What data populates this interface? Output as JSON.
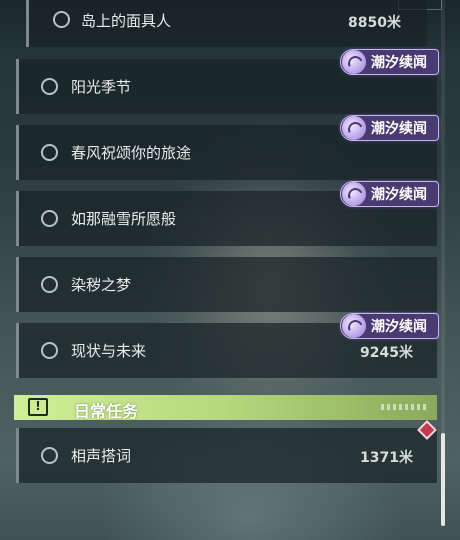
{
  "tag_label": "潮汐续闻",
  "quests": [
    {
      "name": "岛上的面具人",
      "distance": "8850米",
      "tagged": false
    },
    {
      "name": "阳光季节",
      "distance": "",
      "tagged": true
    },
    {
      "name": "春风祝颂你的旅途",
      "distance": "",
      "tagged": true
    },
    {
      "name": "如那融雪所愿般",
      "distance": "",
      "tagged": true
    },
    {
      "name": "染秽之梦",
      "distance": "",
      "tagged": false
    },
    {
      "name": "现状与未来",
      "distance": "9245米",
      "tagged": true
    }
  ],
  "daily_section": {
    "title": "日常任务",
    "icon": "alert-icon",
    "items": [
      {
        "name": "相声搭词",
        "distance": "1371米"
      }
    ]
  },
  "colors": {
    "tag_bg": "#4a3a72",
    "section_bg": "#c2e18a",
    "pin": "#c43a4c"
  }
}
